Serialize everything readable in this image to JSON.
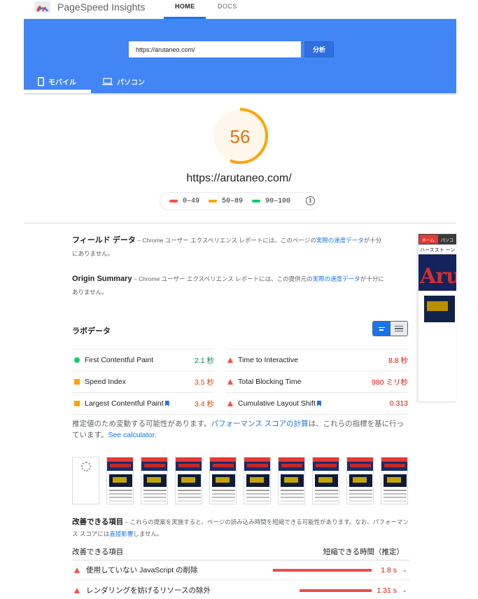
{
  "brand": {
    "name": "PageSpeed Insights"
  },
  "nav": {
    "home": "HOME",
    "docs": "DOCS"
  },
  "search": {
    "url_value": "https://arutaneo.com/",
    "analyze_label": "分析"
  },
  "devices": {
    "mobile": "モバイル",
    "desktop": "パソコン"
  },
  "score": {
    "value": "56",
    "tested_url": "https://arutaneo.com/",
    "fraction": 0.56,
    "color": "#ffa400"
  },
  "legend": [
    {
      "label": "0–49",
      "color": "#ff4e42"
    },
    {
      "label": "50–89",
      "color": "#ffa400"
    },
    {
      "label": "90–100",
      "color": "#0cce6b"
    }
  ],
  "field_data": {
    "title": "フィールド データ",
    "desc_prefix": " – Chrome ユーザー エクスペリエンス レポートには、このページの",
    "desc_link": "実際の速度データ",
    "desc_suffix": "が十分にありません。"
  },
  "origin_summary": {
    "title": "Origin Summary",
    "desc_prefix": " – Chrome ユーザー エクスペリエンス レポートには、この提供元の",
    "desc_link": "実際の速度データ",
    "desc_suffix": "が十分にありません。"
  },
  "lab": {
    "title": "ラボデータ"
  },
  "metrics": [
    {
      "label": "First Contentful Paint",
      "value": "2.1 秒",
      "status": "green"
    },
    {
      "label": "Time to Interactive",
      "value": "8.8 秒",
      "status": "red"
    },
    {
      "label": "Speed Index",
      "value": "3.5 秒",
      "status": "orange"
    },
    {
      "label": "Total Blocking Time",
      "value": "980 ミリ秒",
      "status": "red"
    },
    {
      "label": "Largest Contentful Paint",
      "value": "3.4 秒",
      "status": "orange"
    },
    {
      "label": "Cumulative Layout Shift",
      "value": "0.313",
      "status": "red"
    }
  ],
  "note": {
    "prefix": "推定値のため変動する可能性があります。",
    "link1": "パフォーマンス スコアの計算",
    "middle": "は、これらの指標を基に行っています。",
    "link2": "See calculator."
  },
  "opportunities": {
    "title": "改善できる項目",
    "desc_prefix": " – これらの提案を実施すると、ページの読み込み時間を短縮できる可能性があります。なお、パフォーマンス スコアには",
    "desc_link": "直接影響",
    "desc_suffix": "しません。",
    "col_item": "改善できる項目",
    "col_savings": "短縮できる時間（推定）",
    "rows": [
      {
        "label": "使用していない JavaScript の削除",
        "value": "1.8 s",
        "fraction": 1.0
      },
      {
        "label": "レンダリングを妨げるリソースの除外",
        "value": "1.31 s",
        "fraction": 0.73
      }
    ]
  },
  "preview": {
    "home_tab": "ホーム",
    "pc_tab": "パソコ",
    "subtitle": "ハーススト ーン",
    "banner_text": "Aru"
  }
}
